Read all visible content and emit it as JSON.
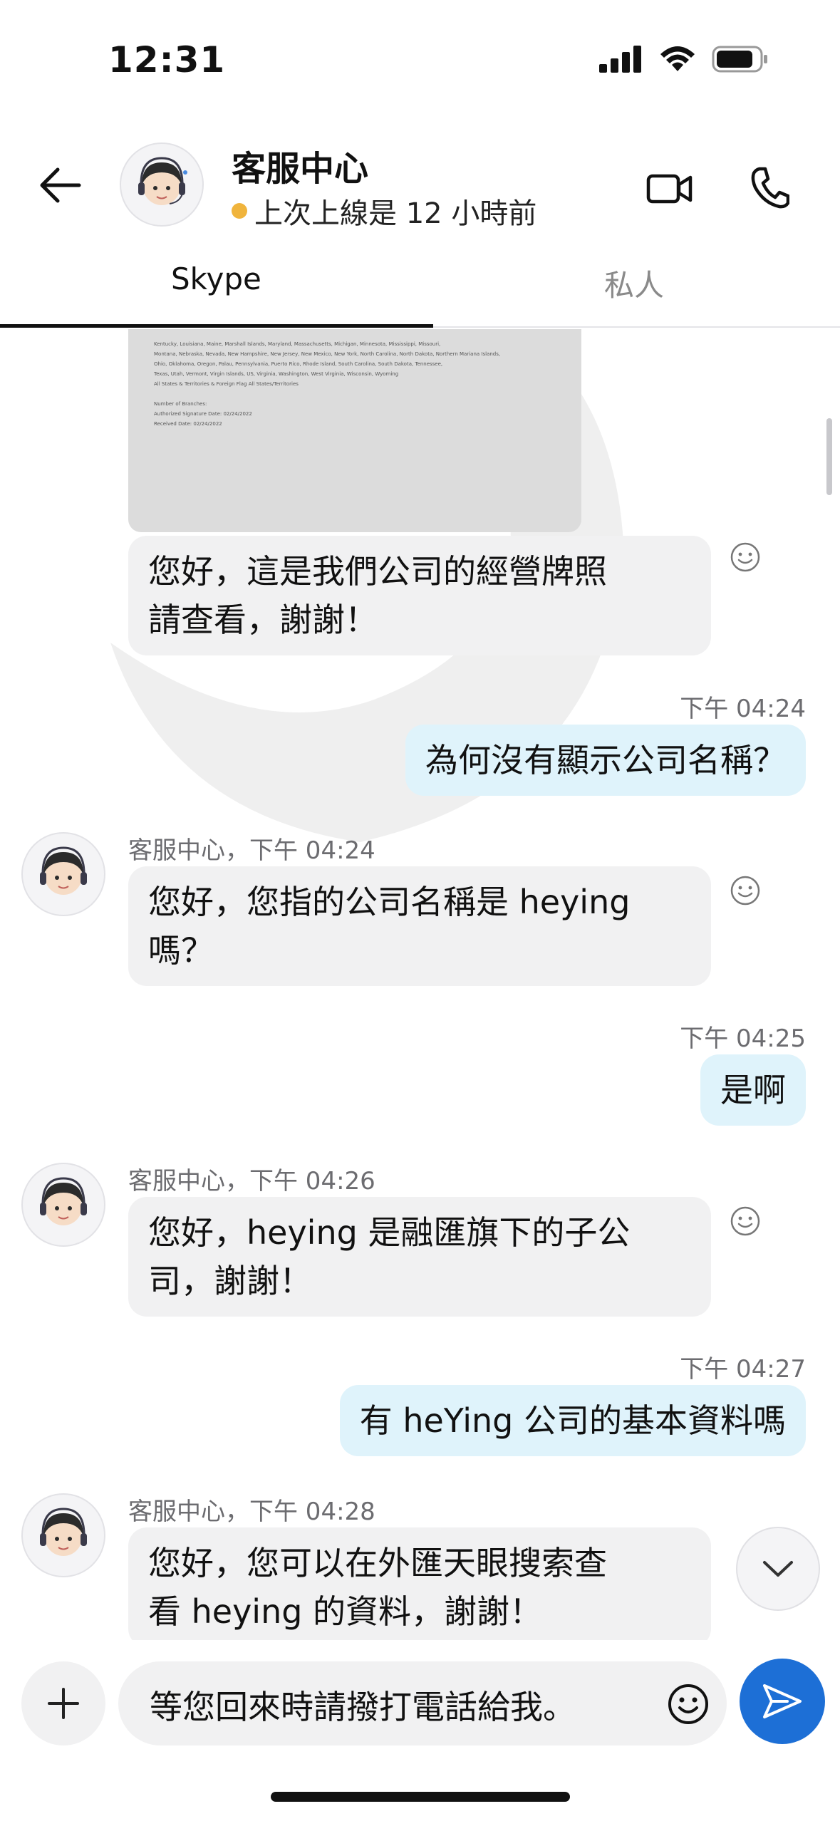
{
  "status_bar": {
    "time": "12:31"
  },
  "header": {
    "contact_name": "客服中心",
    "last_seen": "上次上線是 12 小時前",
    "status_color": "#f0b43c"
  },
  "tabs": [
    {
      "label": "Skype",
      "active": true
    },
    {
      "label": "私人",
      "active": false
    }
  ],
  "messages": [
    {
      "direction": "in",
      "line1": "您好，這是我們公司的經營牌照",
      "line2": "請查看，謝謝！"
    },
    {
      "direction": "out",
      "time": "下午 04:24",
      "text": "為何沒有顯示公司名稱？"
    },
    {
      "direction": "in",
      "sender": "客服中心，下午 04:24",
      "line1": "您好，您指的公司名稱是 heying",
      "line2": "嗎？"
    },
    {
      "direction": "out",
      "time": "下午 04:25",
      "text": "是啊"
    },
    {
      "direction": "in",
      "sender": "客服中心，下午 04:26",
      "line1": "您好，heying 是融匯旗下的子公",
      "line2": "司，謝謝！"
    },
    {
      "direction": "out",
      "time": "下午 04:27",
      "text": "有 heYing 公司的基本資料嗎"
    },
    {
      "direction": "in",
      "sender": "客服中心，下午 04:28",
      "line1": "您好，您可以在外匯天眼搜索查",
      "line2": "看 heying 的資料，謝謝！"
    }
  ],
  "attachment": {
    "lines": [
      "Kentucky, Louisiana, Maine, Marshall Islands, Maryland, Massachusetts, Michigan, Minnesota, Mississippi, Missouri,",
      "Montana, Nebraska, Nevada, New Hampshire, New Jersey, New Mexico, New York, North Carolina, North Dakota, Northern Mariana Islands,",
      "Ohio, Oklahoma, Oregon, Palau, Pennsylvania, Puerto Rico, Rhode Island, South Carolina, South Dakota, Tennessee,",
      "Texas, Utah, Vermont, Virgin Islands, US, Virginia, Washington, West Virginia, Wisconsin, Wyoming",
      "All States & Territories & Foreign Flag   All States/Territories",
      "",
      "Number of Branches:",
      "Authorized Signature Date: 02/24/2022",
      "Received Date:  02/24/2022"
    ]
  },
  "composer": {
    "text": "等您回來時請撥打電話給我。"
  },
  "icons": {
    "back": "arrow-left-icon",
    "video": "video-camera-icon",
    "call": "phone-icon",
    "react": "smiley-icon",
    "add": "plus-icon",
    "emoji": "smiley-icon",
    "send": "send-icon",
    "scroll_down": "chevron-down-icon"
  },
  "colors": {
    "accent": "#1d6fd6",
    "outgoing_bubble": "#dff3fb",
    "incoming_bubble": "#f1f1f2"
  }
}
